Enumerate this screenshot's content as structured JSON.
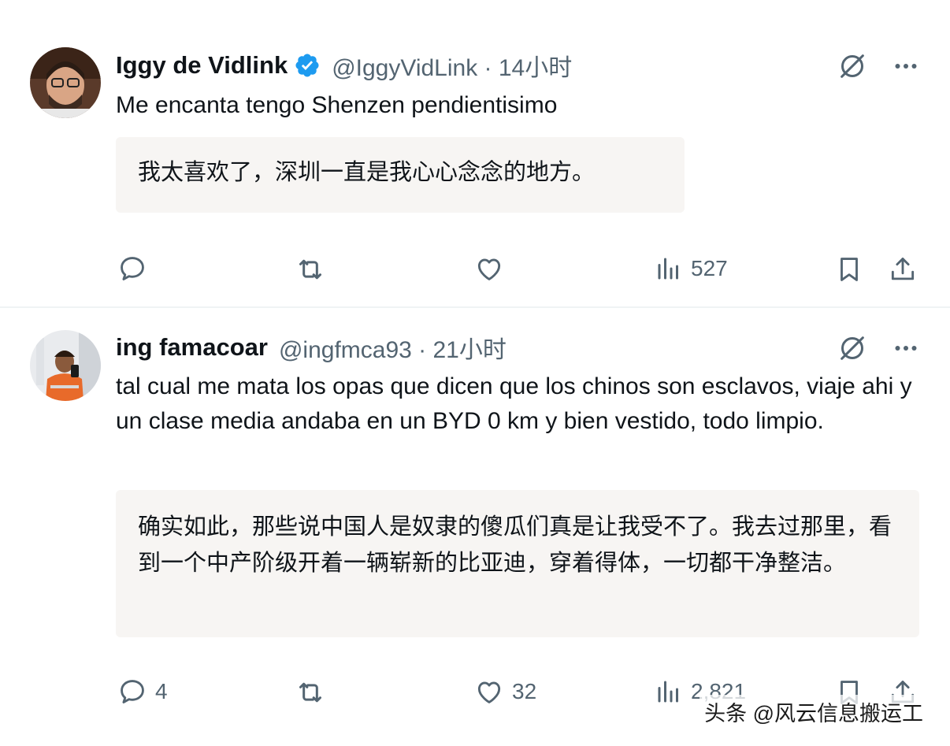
{
  "tweets": [
    {
      "display_name": "Iggy de Vidlink",
      "verified": true,
      "handle_meta": "@IggyVidLink · 14小时",
      "text": "Me encanta tengo Shenzen pendientisimo",
      "translation": "我太喜欢了，深圳一直是我心心念念的地方。",
      "reply_count": "",
      "retweet_count": "",
      "like_count": "",
      "views": "527"
    },
    {
      "display_name": "ing famacoar",
      "verified": false,
      "handle_meta": "@ingfmca93 · 21小时",
      "text": "tal cual me mata los opas que dicen que los chinos son esclavos, viaje ahi y un clase media andaba en un BYD 0 km y bien vestido, todo limpio.",
      "translation": "确实如此，那些说中国人是奴隶的傻瓜们真是让我受不了。我去过那里，看到一个中产阶级开着一辆崭新的比亚迪，穿着得体，一切都干净整洁。",
      "reply_count": "4",
      "retweet_count": "",
      "like_count": "32",
      "views": "2,821"
    }
  ],
  "watermark": "头条 @风云信息搬运工",
  "icons": {
    "verified": "verified-badge-icon",
    "grok": "grok-icon",
    "more": "more-icon",
    "reply": "reply-icon",
    "retweet": "retweet-icon",
    "like": "like-icon",
    "views": "views-icon",
    "bookmark": "bookmark-icon",
    "share": "share-icon"
  },
  "colors": {
    "verified_blue": "#1d9bf0",
    "secondary_text": "#536471",
    "translation_bg": "#f7f5f3"
  }
}
